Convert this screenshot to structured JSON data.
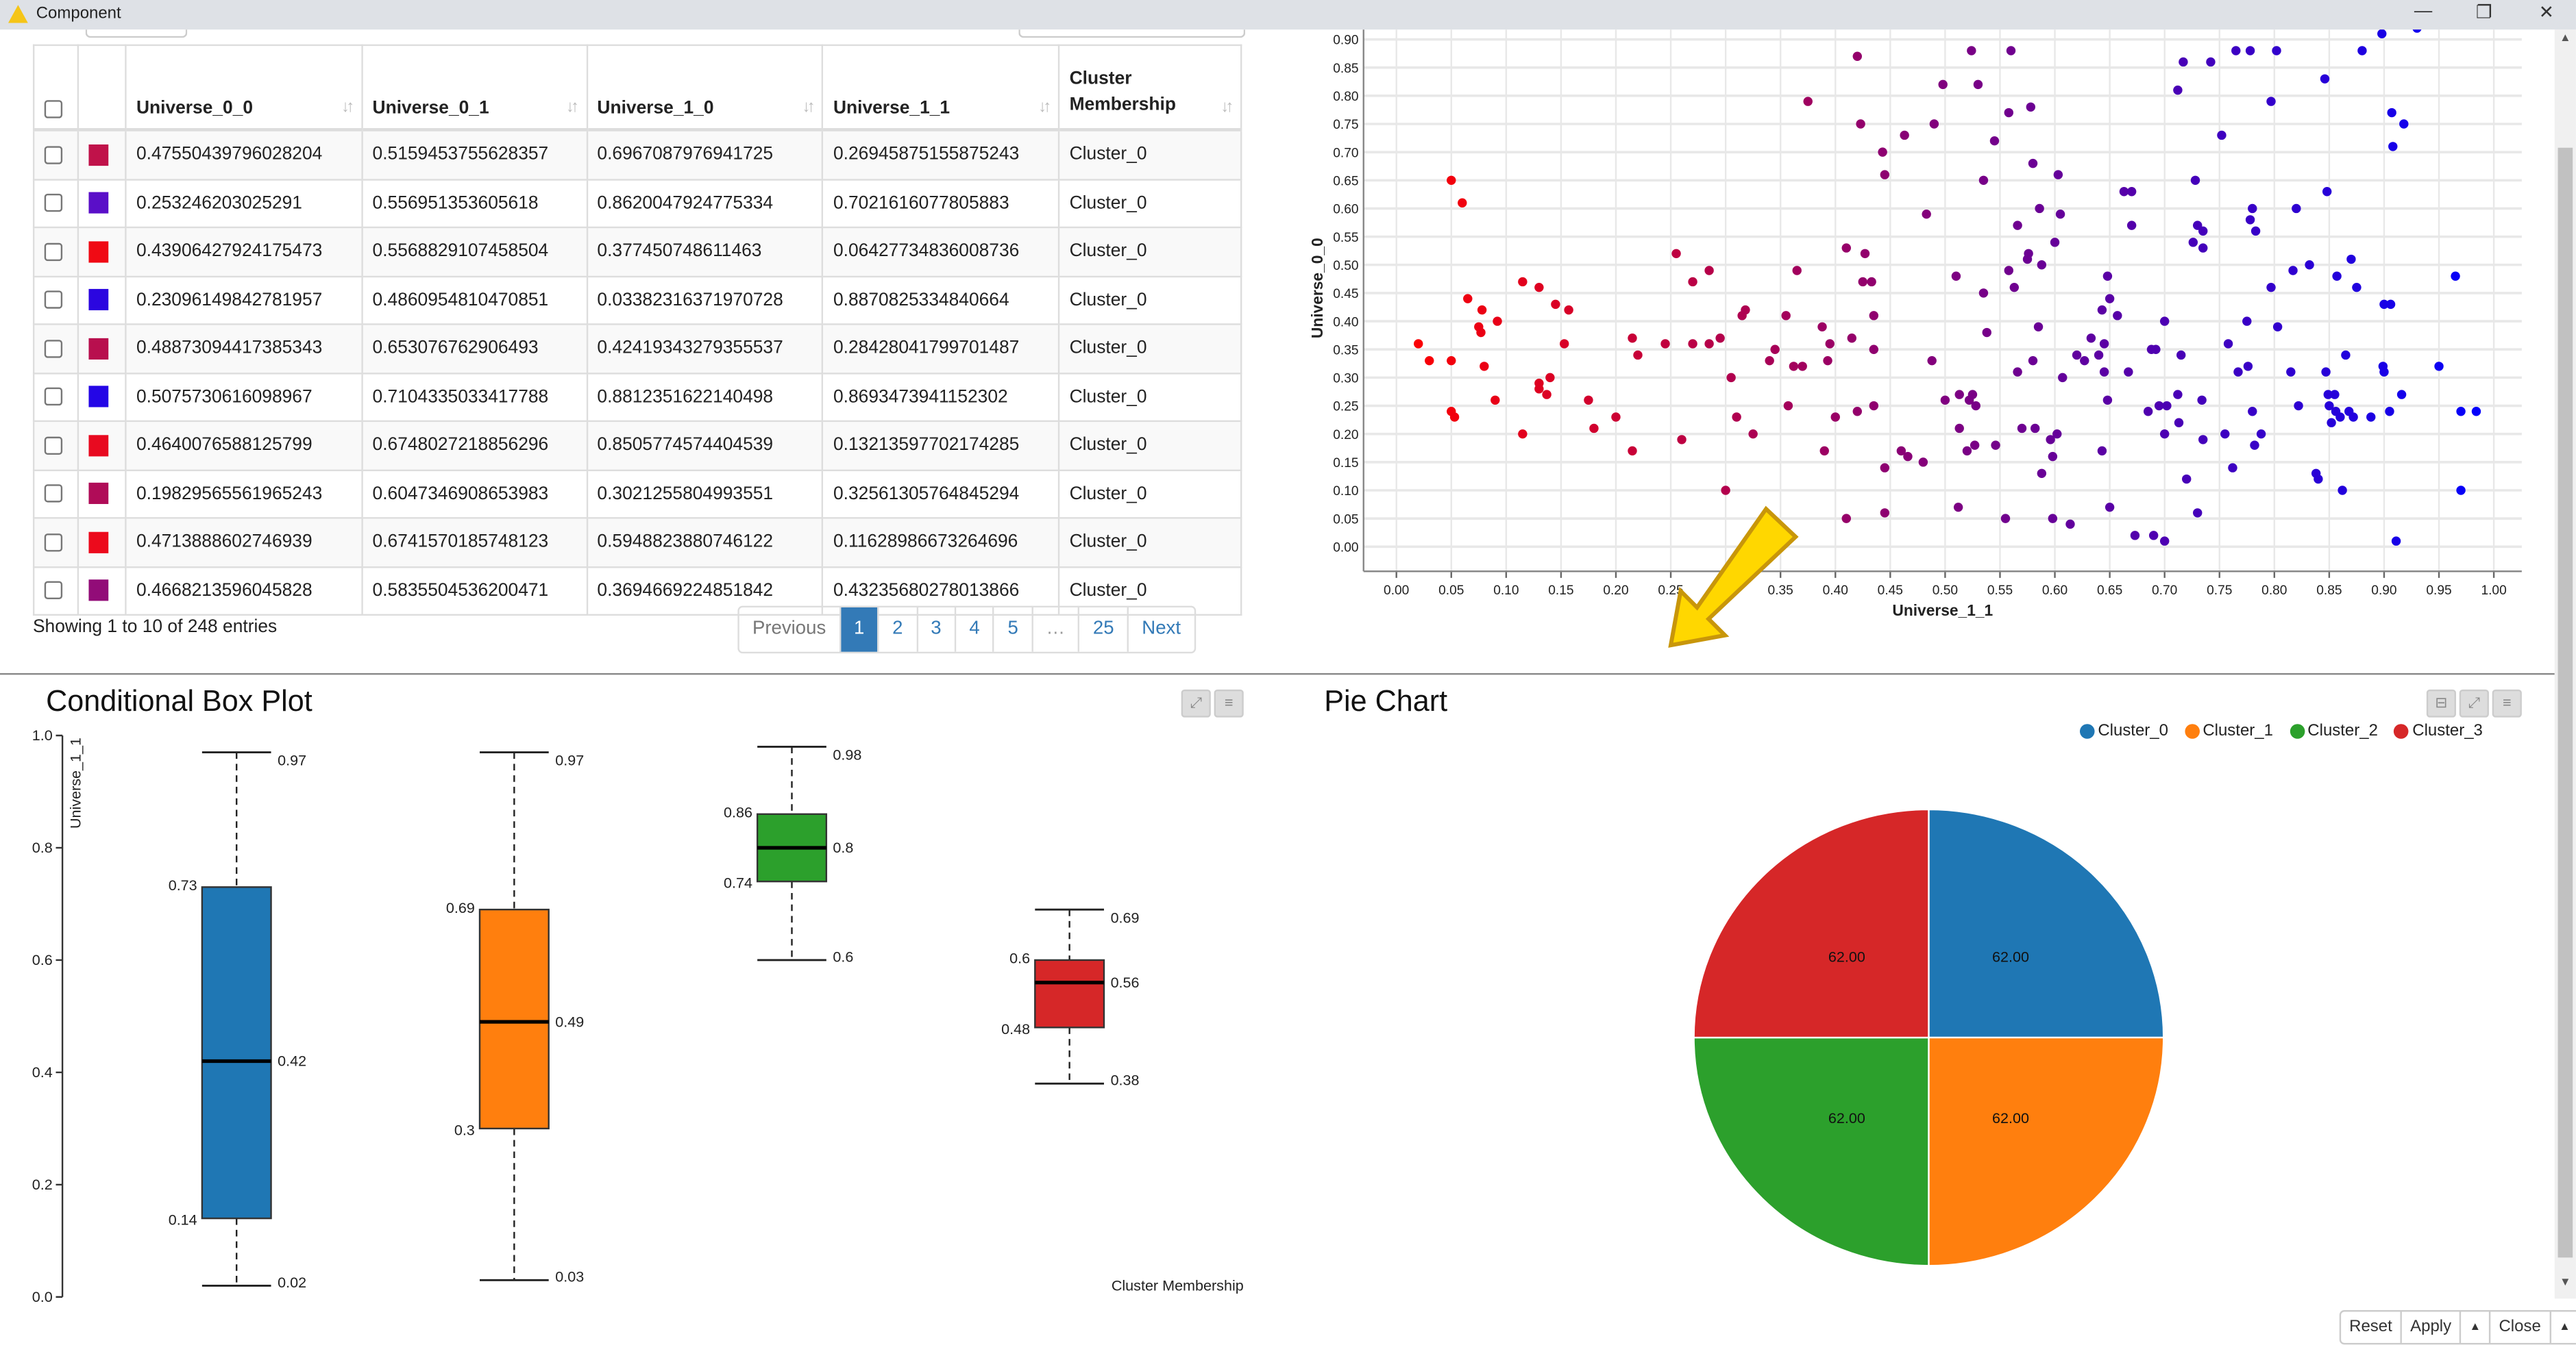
{
  "window": {
    "title": "Component",
    "minimize": "—",
    "restore": "❐",
    "close": "✕"
  },
  "table": {
    "columns": [
      "Universe_0_0",
      "Universe_0_1",
      "Universe_1_0",
      "Universe_1_1",
      "Cluster Membership"
    ],
    "rows": [
      {
        "color": "#c0124a",
        "cells": [
          "0.47550439796028204",
          "0.5159453755628357",
          "0.6967087976941725",
          "0.26945875155875243",
          "Cluster_0"
        ]
      },
      {
        "color": "#5a0fc8",
        "cells": [
          "0.253246203025291",
          "0.556951353605618",
          "0.8620047924775334",
          "0.7021616077805883",
          "Cluster_0"
        ]
      },
      {
        "color": "#f00a14",
        "cells": [
          "0.43906427924175473",
          "0.5568829107458504",
          "0.377450748611463",
          "0.06427734836008736",
          "Cluster_0"
        ]
      },
      {
        "color": "#2b06e0",
        "cells": [
          "0.23096149842781957",
          "0.4860954810470851",
          "0.03382316371970728",
          "0.8870825334840664",
          "Cluster_0"
        ]
      },
      {
        "color": "#b80f4e",
        "cells": [
          "0.48873094417385343",
          "0.653076762906493",
          "0.42419343279355537",
          "0.28428041799701487",
          "Cluster_0"
        ]
      },
      {
        "color": "#2406e6",
        "cells": [
          "0.5075730616098967",
          "0.7104335033417788",
          "0.8812351622140498",
          "0.8693473941152302",
          "Cluster_0"
        ]
      },
      {
        "color": "#e80a20",
        "cells": [
          "0.4640076588125799",
          "0.6748027218856296",
          "0.8505774574404539",
          "0.13213597702174285",
          "Cluster_0"
        ]
      },
      {
        "color": "#b00c58",
        "cells": [
          "0.19829565561965243",
          "0.6047346908653983",
          "0.3021255804993551",
          "0.32561305764845294",
          "Cluster_0"
        ]
      },
      {
        "color": "#ec0a1c",
        "cells": [
          "0.4713888602746939",
          "0.6741570185748123",
          "0.5948823880746122",
          "0.11628986673264696",
          "Cluster_0"
        ]
      },
      {
        "color": "#920c78",
        "cells": [
          "0.4668213596045828",
          "0.5835504536200471",
          "0.3694669224851842",
          "0.43235680278013866",
          "Cluster_0"
        ]
      }
    ],
    "info": "Showing 1 to 10 of 248 entries",
    "pagination": [
      "Previous",
      "1",
      "2",
      "3",
      "4",
      "5",
      "…",
      "25",
      "Next"
    ],
    "active_page": "1"
  },
  "scatter": {
    "chart_data": {
      "type": "scatter",
      "xlabel": "Universe_1_1",
      "ylabel": "Universe_0_0",
      "xlim": [
        0.0,
        1.0
      ],
      "ylim": [
        0.0,
        0.9
      ],
      "xticks": [
        "0.00",
        "0.05",
        "0.10",
        "0.15",
        "0.20",
        "0.25",
        "0.30",
        "0.35",
        "0.40",
        "0.45",
        "0.50",
        "0.55",
        "0.60",
        "0.65",
        "0.70",
        "0.75",
        "0.80",
        "0.85",
        "0.90",
        "0.95",
        "1.00"
      ],
      "yticks": [
        "0.00",
        "0.05",
        "0.10",
        "0.15",
        "0.20",
        "0.25",
        "0.30",
        "0.35",
        "0.40",
        "0.45",
        "0.50",
        "0.55",
        "0.60",
        "0.65",
        "0.70",
        "0.75",
        "0.80",
        "0.85",
        "0.90"
      ],
      "color_scale": [
        "#ff0000",
        "#0000ff"
      ],
      "points": [
        [
          0.02,
          0.36
        ],
        [
          0.03,
          0.33
        ],
        [
          0.05,
          0.65
        ],
        [
          0.05,
          0.33
        ],
        [
          0.05,
          0.24
        ],
        [
          0.053,
          0.23
        ],
        [
          0.06,
          0.61
        ],
        [
          0.065,
          0.44
        ],
        [
          0.075,
          0.39
        ],
        [
          0.077,
          0.38
        ],
        [
          0.078,
          0.42
        ],
        [
          0.08,
          0.32
        ],
        [
          0.09,
          0.26
        ],
        [
          0.092,
          0.4
        ],
        [
          0.115,
          0.47
        ],
        [
          0.115,
          0.2
        ],
        [
          0.13,
          0.46
        ],
        [
          0.13,
          0.28
        ],
        [
          0.13,
          0.29
        ],
        [
          0.137,
          0.27
        ],
        [
          0.14,
          0.3
        ],
        [
          0.145,
          0.43
        ],
        [
          0.153,
          0.36
        ],
        [
          0.157,
          0.42
        ],
        [
          0.175,
          0.26
        ],
        [
          0.18,
          0.21
        ],
        [
          0.2,
          0.23
        ],
        [
          0.215,
          0.37
        ],
        [
          0.215,
          0.17
        ],
        [
          0.22,
          0.34
        ],
        [
          0.245,
          0.36
        ],
        [
          0.255,
          0.52
        ],
        [
          0.26,
          0.19
        ],
        [
          0.27,
          0.47
        ],
        [
          0.27,
          0.36
        ],
        [
          0.285,
          0.49
        ],
        [
          0.285,
          0.36
        ],
        [
          0.295,
          0.37
        ],
        [
          0.3,
          0.1
        ],
        [
          0.305,
          0.3
        ],
        [
          0.31,
          0.23
        ],
        [
          0.315,
          0.41
        ],
        [
          0.318,
          0.42
        ],
        [
          0.325,
          0.2
        ],
        [
          0.34,
          0.33
        ],
        [
          0.345,
          0.35
        ],
        [
          0.355,
          0.41
        ],
        [
          0.357,
          0.25
        ],
        [
          0.362,
          0.32
        ],
        [
          0.365,
          0.49
        ],
        [
          0.37,
          0.32
        ],
        [
          0.375,
          0.79
        ],
        [
          0.388,
          0.39
        ],
        [
          0.39,
          0.17
        ],
        [
          0.393,
          0.33
        ],
        [
          0.395,
          0.36
        ],
        [
          0.4,
          0.23
        ],
        [
          0.41,
          0.53
        ],
        [
          0.41,
          0.05
        ],
        [
          0.415,
          0.37
        ],
        [
          0.42,
          0.87
        ],
        [
          0.42,
          0.24
        ],
        [
          0.423,
          0.75
        ],
        [
          0.425,
          0.47
        ],
        [
          0.427,
          0.52
        ],
        [
          0.433,
          0.47
        ],
        [
          0.435,
          0.41
        ],
        [
          0.435,
          0.35
        ],
        [
          0.435,
          0.25
        ],
        [
          0.443,
          0.7
        ],
        [
          0.445,
          0.66
        ],
        [
          0.445,
          0.14
        ],
        [
          0.445,
          0.06
        ],
        [
          0.463,
          0.73
        ],
        [
          0.46,
          0.17
        ],
        [
          0.466,
          0.16
        ],
        [
          0.48,
          0.15
        ],
        [
          0.483,
          0.59
        ],
        [
          0.488,
          0.33
        ],
        [
          0.49,
          0.75
        ],
        [
          0.498,
          0.82
        ],
        [
          0.5,
          0.26
        ],
        [
          0.51,
          0.48
        ],
        [
          0.512,
          0.07
        ],
        [
          0.513,
          0.27
        ],
        [
          0.513,
          0.21
        ],
        [
          0.52,
          0.17
        ],
        [
          0.522,
          0.26
        ],
        [
          0.524,
          0.88
        ],
        [
          0.525,
          0.27
        ],
        [
          0.528,
          0.25
        ],
        [
          0.527,
          0.18
        ],
        [
          0.53,
          0.82
        ],
        [
          0.535,
          0.45
        ],
        [
          0.535,
          0.65
        ],
        [
          0.538,
          0.38
        ],
        [
          0.545,
          0.72
        ],
        [
          0.546,
          0.18
        ],
        [
          0.555,
          0.05
        ],
        [
          0.558,
          0.77
        ],
        [
          0.56,
          0.88
        ],
        [
          0.558,
          0.49
        ],
        [
          0.563,
          0.46
        ],
        [
          0.566,
          0.57
        ],
        [
          0.566,
          0.31
        ],
        [
          0.57,
          0.21
        ],
        [
          0.575,
          0.51
        ],
        [
          0.576,
          0.52
        ],
        [
          0.578,
          0.78
        ],
        [
          0.58,
          0.68
        ],
        [
          0.58,
          0.33
        ],
        [
          0.582,
          0.21
        ],
        [
          0.585,
          0.39
        ],
        [
          0.586,
          0.6
        ],
        [
          0.588,
          0.5
        ],
        [
          0.588,
          0.13
        ],
        [
          0.596,
          0.19
        ],
        [
          0.598,
          0.16
        ],
        [
          0.598,
          0.05
        ],
        [
          0.6,
          0.54
        ],
        [
          0.602,
          0.2
        ],
        [
          0.603,
          0.66
        ],
        [
          0.605,
          0.59
        ],
        [
          0.607,
          0.3
        ],
        [
          0.614,
          0.04
        ],
        [
          0.62,
          0.34
        ],
        [
          0.627,
          0.33
        ],
        [
          0.633,
          0.37
        ],
        [
          0.64,
          0.34
        ],
        [
          0.643,
          0.42
        ],
        [
          0.643,
          0.17
        ],
        [
          0.645,
          0.36
        ],
        [
          0.645,
          0.31
        ],
        [
          0.648,
          0.48
        ],
        [
          0.648,
          0.26
        ],
        [
          0.65,
          0.44
        ],
        [
          0.65,
          0.07
        ],
        [
          0.657,
          0.41
        ],
        [
          0.663,
          0.63
        ],
        [
          0.667,
          0.31
        ],
        [
          0.67,
          0.63
        ],
        [
          0.67,
          0.57
        ],
        [
          0.673,
          0.02
        ],
        [
          0.685,
          0.24
        ],
        [
          0.688,
          0.35
        ],
        [
          0.69,
          0.02
        ],
        [
          0.692,
          0.35
        ],
        [
          0.695,
          0.25
        ],
        [
          0.7,
          0.4
        ],
        [
          0.7,
          0.2
        ],
        [
          0.7,
          0.01
        ],
        [
          0.702,
          0.25
        ],
        [
          0.712,
          0.81
        ],
        [
          0.712,
          0.27
        ],
        [
          0.713,
          0.22
        ],
        [
          0.715,
          0.34
        ],
        [
          0.717,
          0.86
        ],
        [
          0.72,
          0.12
        ],
        [
          0.726,
          0.54
        ],
        [
          0.728,
          0.65
        ],
        [
          0.73,
          0.57
        ],
        [
          0.73,
          0.06
        ],
        [
          0.734,
          0.26
        ],
        [
          0.735,
          0.53
        ],
        [
          0.735,
          0.56
        ],
        [
          0.735,
          0.19
        ],
        [
          0.742,
          0.86
        ],
        [
          0.752,
          0.73
        ],
        [
          0.755,
          0.2
        ],
        [
          0.758,
          0.36
        ],
        [
          0.762,
          0.14
        ],
        [
          0.765,
          0.88
        ],
        [
          0.767,
          0.31
        ],
        [
          0.775,
          0.4
        ],
        [
          0.776,
          0.32
        ],
        [
          0.778,
          0.88
        ],
        [
          0.778,
          0.58
        ],
        [
          0.78,
          0.6
        ],
        [
          0.78,
          0.24
        ],
        [
          0.782,
          0.18
        ],
        [
          0.783,
          0.56
        ],
        [
          0.788,
          0.2
        ],
        [
          0.797,
          0.79
        ],
        [
          0.797,
          0.46
        ],
        [
          0.802,
          0.88
        ],
        [
          0.803,
          0.39
        ],
        [
          0.815,
          0.31
        ],
        [
          0.817,
          0.49
        ],
        [
          0.82,
          0.6
        ],
        [
          0.822,
          0.25
        ],
        [
          0.832,
          0.5
        ],
        [
          0.838,
          0.13
        ],
        [
          0.84,
          0.12
        ],
        [
          0.846,
          0.83
        ],
        [
          0.847,
          0.31
        ],
        [
          0.848,
          0.63
        ],
        [
          0.849,
          0.27
        ],
        [
          0.85,
          0.25
        ],
        [
          0.852,
          0.22
        ],
        [
          0.855,
          0.27
        ],
        [
          0.856,
          0.24
        ],
        [
          0.857,
          0.48
        ],
        [
          0.86,
          0.23
        ],
        [
          0.862,
          0.1
        ],
        [
          0.865,
          0.34
        ],
        [
          0.868,
          0.24
        ],
        [
          0.87,
          0.51
        ],
        [
          0.872,
          0.23
        ],
        [
          0.875,
          0.46
        ],
        [
          0.88,
          0.88
        ],
        [
          0.888,
          0.23
        ],
        [
          0.898,
          0.91
        ],
        [
          0.899,
          0.32
        ],
        [
          0.9,
          0.31
        ],
        [
          0.9,
          0.43
        ],
        [
          0.905,
          0.24
        ],
        [
          0.906,
          0.43
        ],
        [
          0.907,
          0.77
        ],
        [
          0.908,
          0.71
        ],
        [
          0.911,
          0.01
        ],
        [
          0.916,
          0.27
        ],
        [
          0.918,
          0.75
        ],
        [
          0.93,
          0.92
        ],
        [
          0.95,
          0.32
        ],
        [
          0.965,
          0.48
        ],
        [
          0.97,
          0.1
        ],
        [
          0.97,
          0.24
        ],
        [
          0.984,
          0.24
        ]
      ]
    }
  },
  "boxplot": {
    "title": "Conditional Box Plot",
    "chart_data": {
      "type": "box",
      "ylabel": "Universe_1_1",
      "xlabel": "Cluster Membership",
      "ylim": [
        0.0,
        1.0
      ],
      "yticks": [
        "0.0",
        "0.2",
        "0.4",
        "0.6",
        "0.8",
        "1.0"
      ],
      "series": [
        {
          "name": "Cluster_0",
          "color": "#1f77b4",
          "min": 0.02,
          "q1": 0.14,
          "median": 0.42,
          "q3": 0.73,
          "max": 0.97,
          "labels": {
            "min": "0.02",
            "q1": "0.14",
            "median": "0.42",
            "q3": "0.73",
            "max": "0.97"
          }
        },
        {
          "name": "Cluster_1",
          "color": "#ff7f0e",
          "min": 0.03,
          "q1": 0.3,
          "median": 0.49,
          "q3": 0.69,
          "max": 0.97,
          "labels": {
            "min": "0.03",
            "q1": "0.3",
            "median": "0.49",
            "q3": "0.69",
            "max": "0.97"
          }
        },
        {
          "name": "Cluster_2",
          "color": "#2ca02c",
          "min": 0.6,
          "q1": 0.74,
          "median": 0.8,
          "q3": 0.86,
          "max": 0.98,
          "labels": {
            "min": "0.6",
            "q1": "0.74",
            "median": "0.8",
            "q3": "0.86",
            "max": "0.98"
          }
        },
        {
          "name": "Cluster_3",
          "color": "#d62728",
          "min": 0.38,
          "q1": 0.48,
          "median": 0.56,
          "q3": 0.6,
          "max": 0.69,
          "labels": {
            "min": "0.38",
            "q1": "0.48",
            "median": "0.56",
            "q3": "0.6",
            "max": "0.69"
          }
        }
      ]
    }
  },
  "pie": {
    "title": "Pie Chart",
    "chart_data": {
      "type": "pie",
      "legend_position": "top-right",
      "slices": [
        {
          "label": "Cluster_0",
          "value": 62.0,
          "display": "62.00",
          "color": "#1f77b4"
        },
        {
          "label": "Cluster_1",
          "value": 62.0,
          "display": "62.00",
          "color": "#ff7f0e"
        },
        {
          "label": "Cluster_2",
          "value": 62.0,
          "display": "62.00",
          "color": "#2ca02c"
        },
        {
          "label": "Cluster_3",
          "value": 62.0,
          "display": "62.00",
          "color": "#d62728"
        }
      ]
    }
  },
  "panel_controls": {
    "expand": "⤢",
    "menu": "≡",
    "minimize": "⊟"
  },
  "footer": {
    "reset": "Reset",
    "apply": "Apply",
    "apply_menu": "▲",
    "close": "Close",
    "close_menu": "▲"
  },
  "scroll": {
    "up": "▲",
    "down": "▼"
  }
}
